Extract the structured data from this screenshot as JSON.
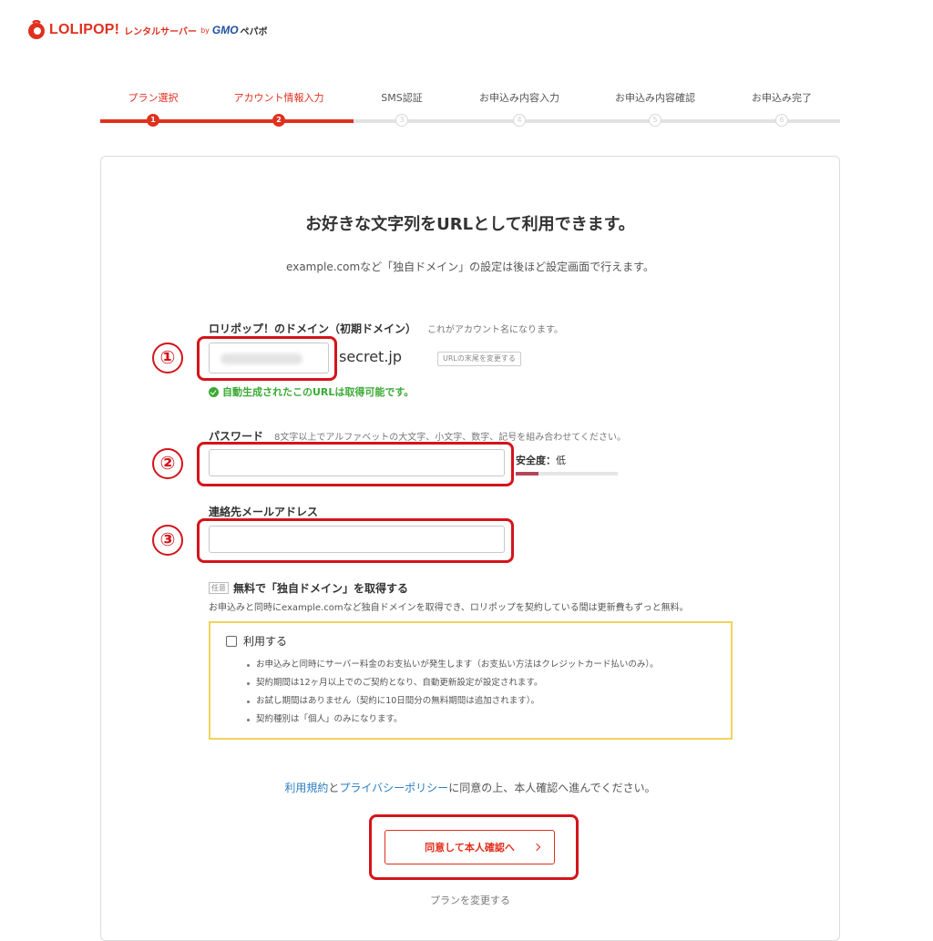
{
  "header": {
    "brand": "LOLIPOP!",
    "brand_sub": "レンタルサーバー",
    "by": "by",
    "company": "GMO",
    "company_sub": "ペパボ",
    "brand_color": "#e0301e"
  },
  "steps": [
    {
      "label": "プラン選択",
      "num": "1",
      "done": true
    },
    {
      "label": "アカウント情報入力",
      "num": "2",
      "done": true
    },
    {
      "label": "SMS認証",
      "num": "3",
      "done": false
    },
    {
      "label": "お申込み内容入力",
      "num": "4",
      "done": false
    },
    {
      "label": "お申込み内容確認",
      "num": "5",
      "done": false
    },
    {
      "label": "お申込み完了",
      "num": "6",
      "done": false
    }
  ],
  "main": {
    "title": "お好きな文字列をURLとして利用できます。",
    "subtitle": "example.comなど「独自ドメイン」の設定は後ほど設定画面で行えます。"
  },
  "domain": {
    "label": "ロリポップ！のドメイン（初期ドメイン）",
    "note": "これがアカウント名になります。",
    "value": "",
    "suffix": "secret.jp",
    "change_button": "URLの末尾を変更する",
    "available_msg": "自動生成されたこのURLは取得可能です。"
  },
  "password": {
    "label": "パスワード",
    "note": "8文字以上でアルファベットの大文字、小文字、数字、記号を組み合わせてください。",
    "value": "",
    "strength_label": "安全度：",
    "strength_level": "低",
    "strength_fraction": 0.22
  },
  "email": {
    "label": "連絡先メールアドレス",
    "value": ""
  },
  "free_domain": {
    "badge": "任意",
    "title": "無料で「独自ドメイン」を取得する",
    "desc": "お申込みと同時にexample.comなど独自ドメインを取得でき、ロリポップを契約している間は更新費もずっと無料。",
    "checkbox_label": "利用する",
    "checked": false,
    "notes": [
      "お申込みと同時にサーバー料金のお支払いが発生します（お支払い方法はクレジットカード払いのみ）。",
      "契約期間は12ヶ月以上でのご契約となり、自動更新設定が設定されます。",
      "お試し期間はありません（契約に10日間分の無料期間は追加されます）。",
      "契約種別は「個人」のみになります。"
    ]
  },
  "agreement": {
    "terms": "利用規約",
    "and": "と",
    "privacy": "プライバシーポリシー",
    "rest": "に同意の上、本人確認へ進んでください。"
  },
  "submit_label": "同意して本人確認へ",
  "change_plan": "プランを変更する",
  "annotations": [
    "①",
    "②",
    "③"
  ],
  "annotation_color": "#d4141b"
}
